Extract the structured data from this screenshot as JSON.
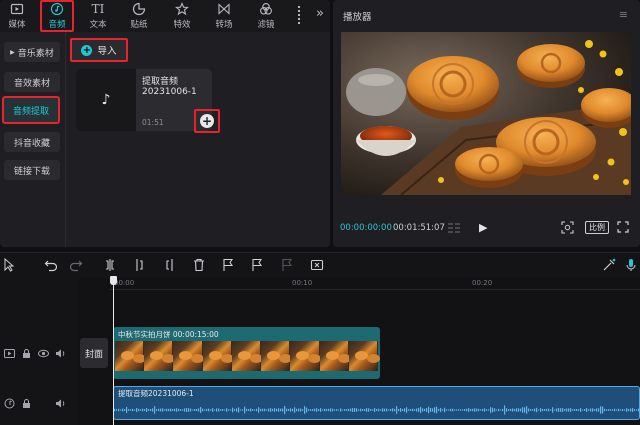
{
  "tabs": [
    {
      "label": "媒体",
      "icon": "media-icon"
    },
    {
      "label": "音频",
      "icon": "audio-icon"
    },
    {
      "label": "文本",
      "icon": "text-icon"
    },
    {
      "label": "贴纸",
      "icon": "sticker-icon"
    },
    {
      "label": "特效",
      "icon": "effects-icon"
    },
    {
      "label": "转场",
      "icon": "transition-icon"
    },
    {
      "label": "滤镜",
      "icon": "filter-icon"
    }
  ],
  "tabs_more": "»",
  "text_icon_glyph": "TI",
  "sidebar": {
    "items": [
      {
        "label": "音乐素材"
      },
      {
        "label": "音效素材"
      },
      {
        "label": "音频提取"
      },
      {
        "label": "抖音收藏"
      },
      {
        "label": "链接下载"
      }
    ]
  },
  "media": {
    "import_label": "导入",
    "card": {
      "title": "提取音频",
      "name": "20231006-1",
      "duration": "01:51",
      "note_glyph": "♪"
    },
    "add_glyph": "+"
  },
  "player": {
    "title": "播放器",
    "menu_glyph": "≡",
    "time_current": "00:00:00:00",
    "time_total": "00:01:51:07",
    "ratio_label": "比例",
    "play_glyph": "▶"
  },
  "timeline": {
    "ruler": [
      {
        "label": "00:00",
        "pos": 0.01
      },
      {
        "label": "00:10",
        "pos": 0.345
      },
      {
        "label": "00:20",
        "pos": 0.685
      }
    ],
    "cover_label": "封面",
    "video_clip_label": "中秋节实拍月饼   00:00:15:00",
    "audio_clip_label": "提取音频20231006-1",
    "frames": 9
  },
  "colors": {
    "accent": "#27c4d6",
    "highlight_frame": "#e8232b",
    "video_clip": "#1c6a72",
    "audio_clip": "#1d4f7a"
  }
}
